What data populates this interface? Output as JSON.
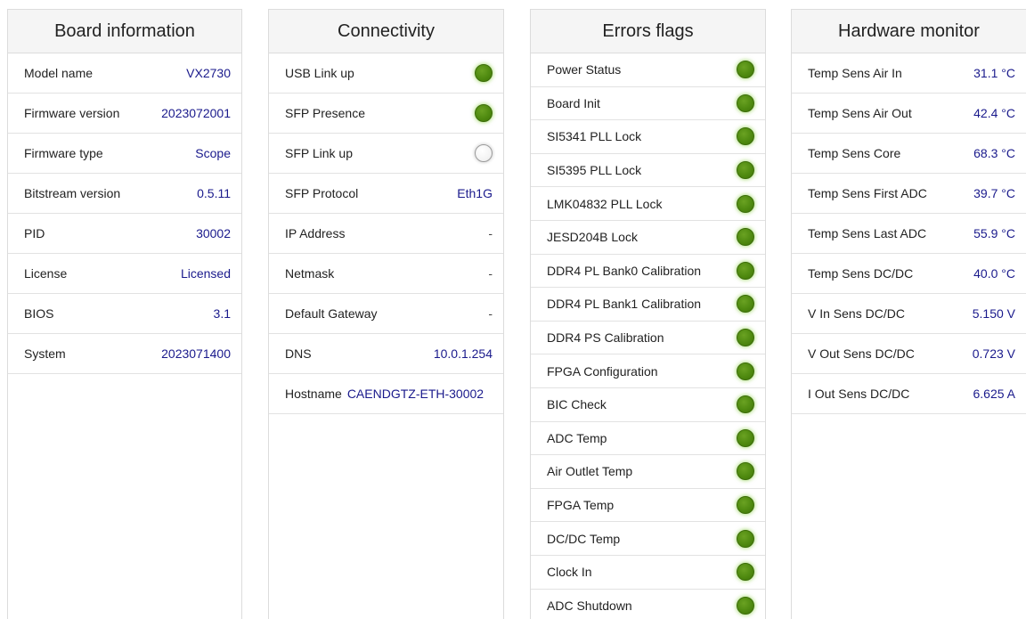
{
  "board": {
    "title": "Board information",
    "rows": [
      {
        "label": "Model name",
        "value": "VX2730"
      },
      {
        "label": "Firmware version",
        "value": "2023072001"
      },
      {
        "label": "Firmware type",
        "value": "Scope"
      },
      {
        "label": "Bitstream version",
        "value": "0.5.11"
      },
      {
        "label": "PID",
        "value": "30002"
      },
      {
        "label": "License",
        "value": "Licensed"
      },
      {
        "label": "BIOS",
        "value": "3.1"
      },
      {
        "label": "System",
        "value": "2023071400"
      }
    ]
  },
  "connectivity": {
    "title": "Connectivity",
    "rows": [
      {
        "label": "USB Link up",
        "status": "on"
      },
      {
        "label": "SFP Presence",
        "status": "on"
      },
      {
        "label": "SFP Link up",
        "status": "off"
      },
      {
        "label": "SFP Protocol",
        "value": "Eth1G"
      },
      {
        "label": "IP Address",
        "value": "-"
      },
      {
        "label": "Netmask",
        "value": "-"
      },
      {
        "label": "Default Gateway",
        "value": "-"
      },
      {
        "label": "DNS",
        "value": "10.0.1.254"
      },
      {
        "label": "Hostname",
        "value": "CAENDGTZ-ETH-30002"
      }
    ]
  },
  "errors": {
    "title": "Errors flags",
    "rows": [
      {
        "label": "Power Status",
        "status": "on"
      },
      {
        "label": "Board Init",
        "status": "on"
      },
      {
        "label": "SI5341 PLL Lock",
        "status": "on"
      },
      {
        "label": "SI5395 PLL Lock",
        "status": "on"
      },
      {
        "label": "LMK04832 PLL Lock",
        "status": "on"
      },
      {
        "label": "JESD204B Lock",
        "status": "on"
      },
      {
        "label": "DDR4 PL Bank0 Calibration",
        "status": "on"
      },
      {
        "label": "DDR4 PL Bank1 Calibration",
        "status": "on"
      },
      {
        "label": "DDR4 PS Calibration",
        "status": "on"
      },
      {
        "label": "FPGA Configuration",
        "status": "on"
      },
      {
        "label": "BIC Check",
        "status": "on"
      },
      {
        "label": "ADC Temp",
        "status": "on"
      },
      {
        "label": "Air Outlet Temp",
        "status": "on"
      },
      {
        "label": "FPGA Temp",
        "status": "on"
      },
      {
        "label": "DC/DC Temp",
        "status": "on"
      },
      {
        "label": "Clock In",
        "status": "on"
      },
      {
        "label": "ADC Shutdown",
        "status": "on"
      }
    ]
  },
  "hardware": {
    "title": "Hardware monitor",
    "rows": [
      {
        "label": "Temp Sens Air In",
        "value": "31.1 °C"
      },
      {
        "label": "Temp Sens Air Out",
        "value": "42.4 °C"
      },
      {
        "label": "Temp Sens Core",
        "value": "68.3 °C"
      },
      {
        "label": "Temp Sens First ADC",
        "value": "39.7 °C"
      },
      {
        "label": "Temp Sens Last ADC",
        "value": "55.9 °C"
      },
      {
        "label": "Temp Sens DC/DC",
        "value": "40.0 °C"
      },
      {
        "label": "V In Sens DC/DC",
        "value": "5.150 V"
      },
      {
        "label": "V Out Sens DC/DC",
        "value": "0.723 V"
      },
      {
        "label": "I Out Sens DC/DC",
        "value": "6.625 A"
      }
    ]
  },
  "colors": {
    "led_on": "#4f8a10",
    "led_off": "#f4f4f4",
    "value_text": "#1a1a8c"
  }
}
